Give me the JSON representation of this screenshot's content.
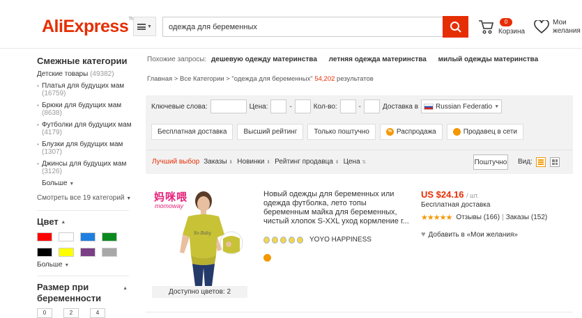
{
  "header": {
    "logo": "AliExpress",
    "logo_tm": "TM",
    "search_value": "одежда для беременных",
    "cart_count": "0",
    "cart_label": "Корзина",
    "wishlist_label": "Мои желания"
  },
  "sidebar": {
    "title": "Смежные категории",
    "parent_label": "Детские товары",
    "parent_count": "(49382)",
    "items": [
      {
        "label": "Платья для будущих мам",
        "count": "(16759)"
      },
      {
        "label": "Брюки для будущих мам",
        "count": "(8638)"
      },
      {
        "label": "Футболки для будущих мам",
        "count": "(4179)"
      },
      {
        "label": "Блузки для будущих мам",
        "count": "(1307)"
      },
      {
        "label": "Джинсы для будущих мам",
        "count": "(3126)"
      }
    ],
    "more": "Больше",
    "view_all": "Смотреть все 19 категорий",
    "color_title": "Цвет",
    "colors": [
      "#ff0000",
      "#ffffff",
      "#1e7fe0",
      "#0a8a1e",
      "#000000",
      "#ffff00",
      "#7b3f86",
      "#a8a8a8"
    ],
    "color_more": "Больше",
    "size_title": "Размер при беременности",
    "sizes": [
      "0",
      "2",
      "4"
    ]
  },
  "related": {
    "label": "Похожие запросы:",
    "items": [
      "дешевую одежду материнства",
      "летняя одежда материнства",
      "милый одежды материнства"
    ]
  },
  "breadcrumb": {
    "path": "Главная > Все Категории > \"одежда для беременных\"",
    "count": "54,202",
    "suffix": "результатов"
  },
  "filters": {
    "keywords_label": "Ключевые слова:",
    "price_label": "Цена:",
    "qty_label": "Кол-во:",
    "dash": "-",
    "ship_to_label": "Доставка в",
    "country": "Russian Federatio",
    "buttons": [
      "Бесплатная доставка",
      "Высший рейтинг",
      "Только поштучно",
      "Распродажа",
      "Продавец в сети"
    ]
  },
  "sort": {
    "best": "Лучший выбор",
    "orders": "Заказы",
    "newest": "Новинки",
    "seller_rating": "Рейтинг продавца",
    "price": "Цена",
    "per_piece": "Поштучно",
    "view_label": "Вид:"
  },
  "product": {
    "brand_cn": "妈咪喂",
    "brand_en": "momoway",
    "colors_available": "Доступно цветов: 2",
    "title": "Новый одежды для беременных или одежда футболка, лето топы беременным майка для беременных, чистый хлопок S-XXL уход кормление г...",
    "seller": "YOYO HAPPINESS",
    "price": "US $24.16",
    "price_unit": "/ шт.",
    "shipping": "Бесплатная доставка",
    "reviews": "Отзывы (166)",
    "separator": "|",
    "orders": "Заказы (152)",
    "rating": 5,
    "wishlist": "Добавить в «Мои желания»",
    "medals": 5
  },
  "colors": {
    "accent": "#e62e04",
    "orange": "#f39800",
    "panel": "#f2f2f2"
  }
}
